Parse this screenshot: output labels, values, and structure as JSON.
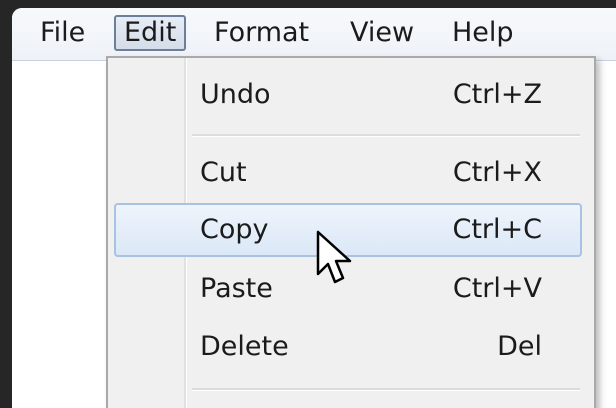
{
  "menubar": {
    "items": [
      {
        "label": "File"
      },
      {
        "label": "Edit"
      },
      {
        "label": "Format"
      },
      {
        "label": "View"
      },
      {
        "label": "Help"
      }
    ],
    "active": "Edit"
  },
  "edit_menu": {
    "items": [
      {
        "label": "Undo",
        "shortcut": "Ctrl+Z"
      },
      {
        "label": "Cut",
        "shortcut": "Ctrl+X"
      },
      {
        "label": "Copy",
        "shortcut": "Ctrl+C",
        "highlighted": true
      },
      {
        "label": "Paste",
        "shortcut": "Ctrl+V"
      },
      {
        "label": "Delete",
        "shortcut": "Del"
      }
    ]
  },
  "icons": {
    "cursor": "mouse-pointer-icon"
  },
  "colors": {
    "highlight_border": "#a8c3e2",
    "highlight_fill": "#dbe8f7",
    "menu_background": "#f0f0f0",
    "active_menu_border": "#6d7f98"
  }
}
